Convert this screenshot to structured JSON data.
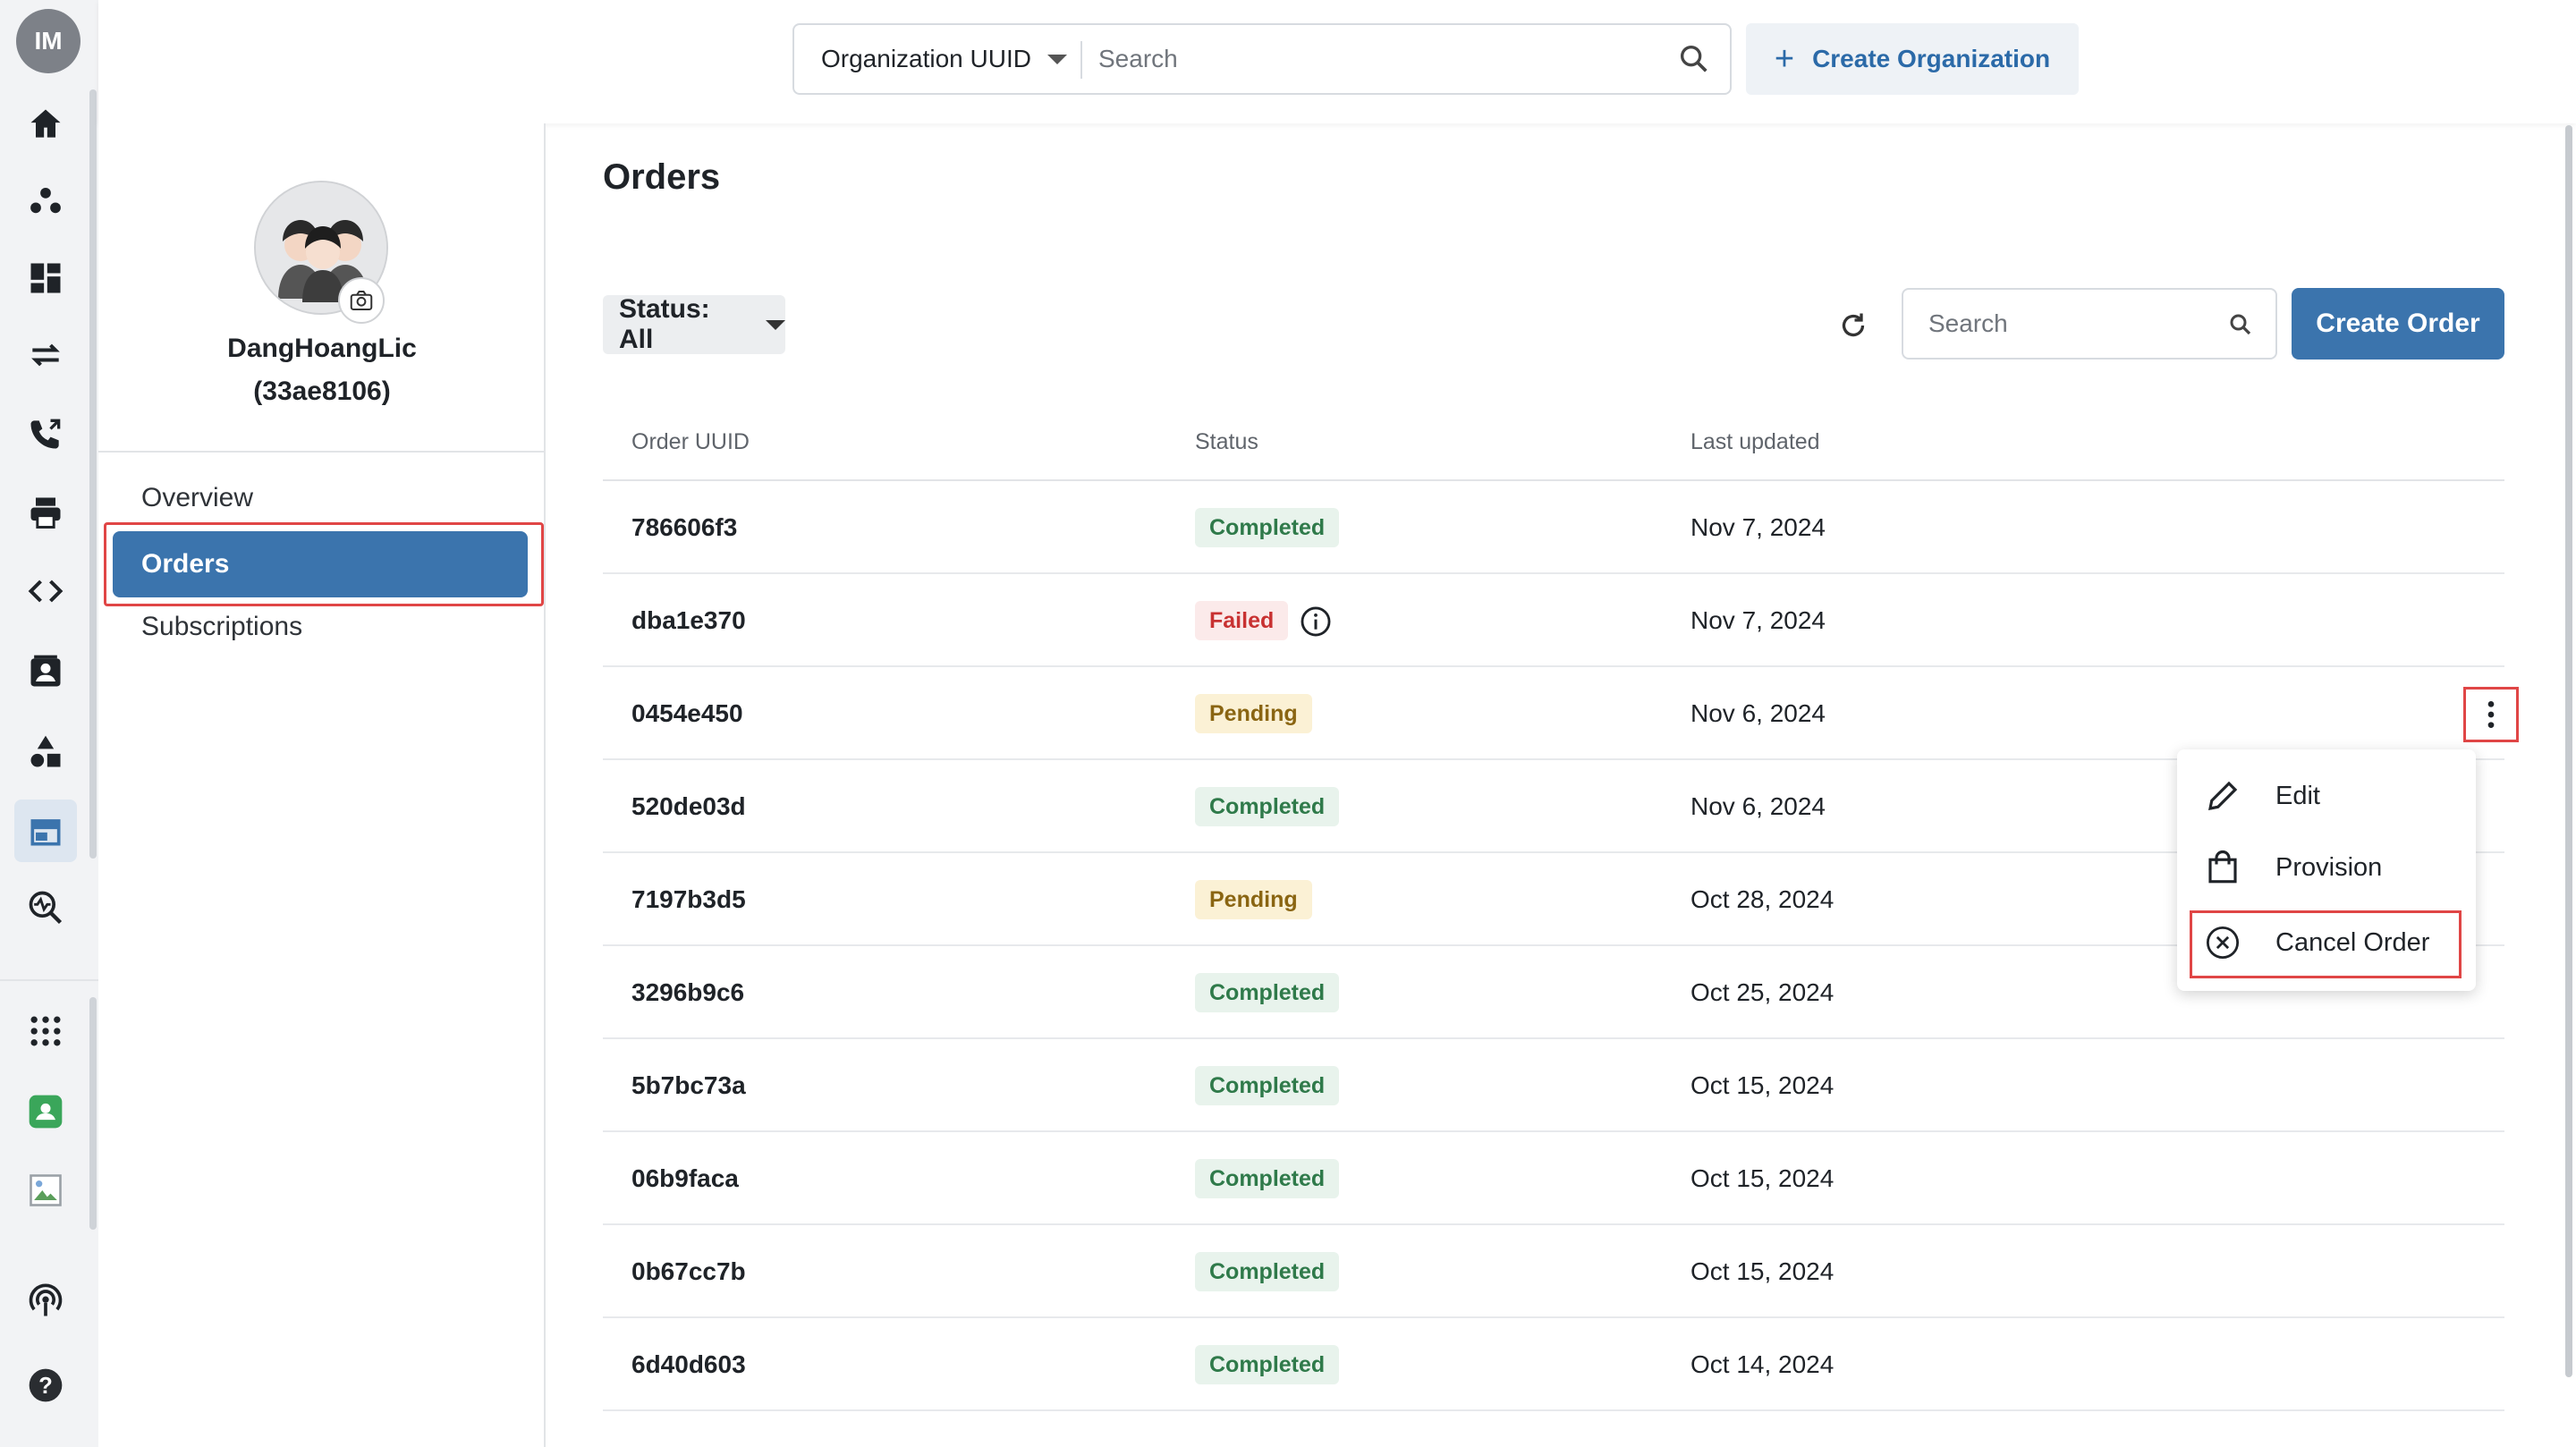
{
  "user": {
    "initials": "IM"
  },
  "rail": {
    "icons": [
      "home-icon",
      "groups-icon",
      "dashboard-icon",
      "transfer-icon",
      "phone-icon",
      "printer-icon",
      "code-icon",
      "contact-card-icon",
      "shapes-icon",
      "store-icon",
      "monitoring-icon",
      "apps-grid-icon",
      "app-badge-icon",
      "broken-image-icon",
      "podcast-icon",
      "help-icon"
    ],
    "active": "store-icon"
  },
  "topbar": {
    "search_scope": "Organization UUID",
    "search_placeholder": "Search",
    "create_org_label": "Create Organization"
  },
  "org": {
    "name": "DangHoangLic",
    "id": "(33ae8106)",
    "nav": [
      {
        "label": "Overview"
      },
      {
        "label": "Orders"
      },
      {
        "label": "Subscriptions"
      }
    ],
    "active_nav": "Orders"
  },
  "main": {
    "title": "Orders",
    "status_filter": "Status: All",
    "search_placeholder": "Search",
    "create_order_label": "Create Order",
    "columns": {
      "uuid": "Order UUID",
      "status": "Status",
      "updated": "Last updated"
    },
    "rows": [
      {
        "uuid": "786606f3",
        "status": "Completed",
        "date": "Nov 7, 2024"
      },
      {
        "uuid": "dba1e370",
        "status": "Failed",
        "date": "Nov 7, 2024"
      },
      {
        "uuid": "0454e450",
        "status": "Pending",
        "date": "Nov 6, 2024"
      },
      {
        "uuid": "520de03d",
        "status": "Completed",
        "date": "Nov 6, 2024"
      },
      {
        "uuid": "7197b3d5",
        "status": "Pending",
        "date": "Oct 28, 2024"
      },
      {
        "uuid": "3296b9c6",
        "status": "Completed",
        "date": "Oct 25, 2024"
      },
      {
        "uuid": "5b7bc73a",
        "status": "Completed",
        "date": "Oct 15, 2024"
      },
      {
        "uuid": "06b9faca",
        "status": "Completed",
        "date": "Oct 15, 2024"
      },
      {
        "uuid": "0b67cc7b",
        "status": "Completed",
        "date": "Oct 15, 2024"
      },
      {
        "uuid": "6d40d603",
        "status": "Completed",
        "date": "Oct 14, 2024"
      }
    ]
  },
  "menu": {
    "items": [
      {
        "label": "Edit",
        "icon": "pencil-icon"
      },
      {
        "label": "Provision",
        "icon": "shopping-bag-icon"
      },
      {
        "label": "Cancel Order",
        "icon": "cancel-circle-icon"
      }
    ]
  },
  "colors": {
    "accent": "#3b74ad",
    "highlight": "#e04646",
    "completed": "#2f7a4a",
    "failed": "#c83232",
    "pending": "#8a6512"
  }
}
